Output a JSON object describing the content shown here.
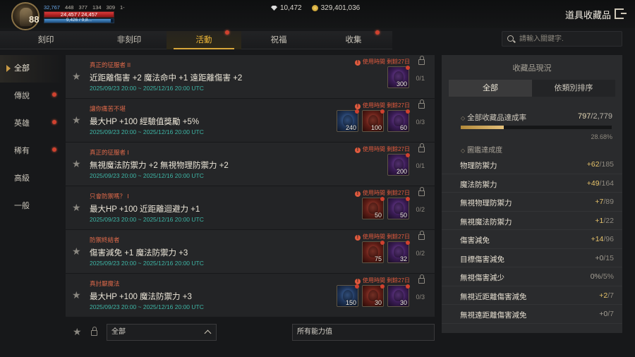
{
  "hud": {
    "level": "88",
    "stats": [
      "32,767",
      "448",
      "377",
      "134",
      "309",
      "1-"
    ],
    "hp_text": "24,457 / 24,457",
    "mp_text": "9,426 / 9,8..."
  },
  "currency": {
    "gems": "10,472",
    "gold": "329,401,036"
  },
  "page_title": "道具收藏品",
  "tabs": [
    "刻印",
    "非刻印",
    "活動",
    "祝福",
    "收集"
  ],
  "search": {
    "placeholder": "請輸入關鍵字."
  },
  "sidebar": [
    "全部",
    "傳說",
    "英雄",
    "稀有",
    "高級",
    "一般"
  ],
  "cards": [
    {
      "subtitle": "真正的征服者 II",
      "title": "近距離傷害 +2 魔法命中 +1 遠距離傷害 +2",
      "date": "2025/09/23 20:00 ~ 2025/12/16 20:00 UTC",
      "warning": "使用時間 剩餘27日",
      "count": "0/1",
      "items": [
        {
          "color": "purple",
          "qty": "300"
        }
      ]
    },
    {
      "subtitle": "讓你痛苦不堪",
      "title": "最大HP +100 經驗值獎勵 +5%",
      "date": "2025/09/23 20:00 ~ 2025/12/16 20:00 UTC",
      "warning": "使用時間 剩餘27日",
      "count": "0/3",
      "items": [
        {
          "color": "blue",
          "qty": "240"
        },
        {
          "color": "red",
          "qty": "100"
        },
        {
          "color": "purple",
          "qty": "60"
        }
      ]
    },
    {
      "subtitle": "真正的征服者 I",
      "title": "無視魔法防禦力 +2 無視物理防禦力 +2",
      "date": "2025/09/23 20:00 ~ 2025/12/16 20:00 UTC",
      "warning": "使用時間 剩餘27日",
      "count": "0/1",
      "items": [
        {
          "color": "purple",
          "qty": "200"
        }
      ]
    },
    {
      "subtitle": "只會防禦嗎？ I",
      "title": "最大HP +100 近距離迴避力 +1",
      "date": "2025/09/23 20:00 ~ 2025/12/16 20:00 UTC",
      "warning": "使用時間 剩餘27日",
      "count": "0/2",
      "items": [
        {
          "color": "red",
          "qty": "50"
        },
        {
          "color": "purple",
          "qty": "50"
        }
      ]
    },
    {
      "subtitle": "防禦終結者",
      "title": "傷害減免 +1 魔法防禦力 +3",
      "date": "2025/09/23 20:00 ~ 2025/12/16 20:00 UTC",
      "warning": "使用時間 剩餘27日",
      "count": "0/2",
      "items": [
        {
          "color": "red",
          "qty": "75"
        },
        {
          "color": "purple",
          "qty": "32"
        }
      ]
    },
    {
      "subtitle": "真討厭魔法",
      "title": "最大HP +100 魔法防禦力 +3",
      "date": "2025/09/23 20:00 ~ 2025/12/16 20:00 UTC",
      "warning": "使用時間 剩餘27日",
      "count": "0/3",
      "items": [
        {
          "color": "blue",
          "qty": "150"
        },
        {
          "color": "red",
          "qty": "30"
        },
        {
          "color": "purple",
          "qty": "30"
        }
      ]
    }
  ],
  "filter": {
    "grade_select": "全部",
    "ability_select": "所有能力值"
  },
  "panel": {
    "title": "收藏品現況",
    "tabs": [
      "全部",
      "依類別排序"
    ],
    "rate_label": "全部收藏品達成率",
    "rate_done": "797",
    "rate_total": "/2,779",
    "rate_percent": "28.68%",
    "rate_fraction": 0.2868,
    "section_label": "圖鑑達成度",
    "stats": [
      {
        "name": "物理防禦力",
        "value": "+62",
        "total": "/185"
      },
      {
        "name": "魔法防禦力",
        "value": "+49",
        "total": "/164"
      },
      {
        "name": "無視物理防禦力",
        "value": "+7",
        "total": "/89"
      },
      {
        "name": "無視魔法防禦力",
        "value": "+1",
        "total": "/22"
      },
      {
        "name": "傷害減免",
        "value": "+14",
        "total": "/96"
      },
      {
        "name": "目標傷害減免",
        "value": "+0",
        "total": "/15"
      },
      {
        "name": "無視傷害減少",
        "value": "0%",
        "total": "/5%"
      },
      {
        "name": "無視近距離傷害減免",
        "value": "+2",
        "total": "/7"
      },
      {
        "name": "無視遠距離傷害減免",
        "value": "+0",
        "total": "/7"
      }
    ]
  }
}
